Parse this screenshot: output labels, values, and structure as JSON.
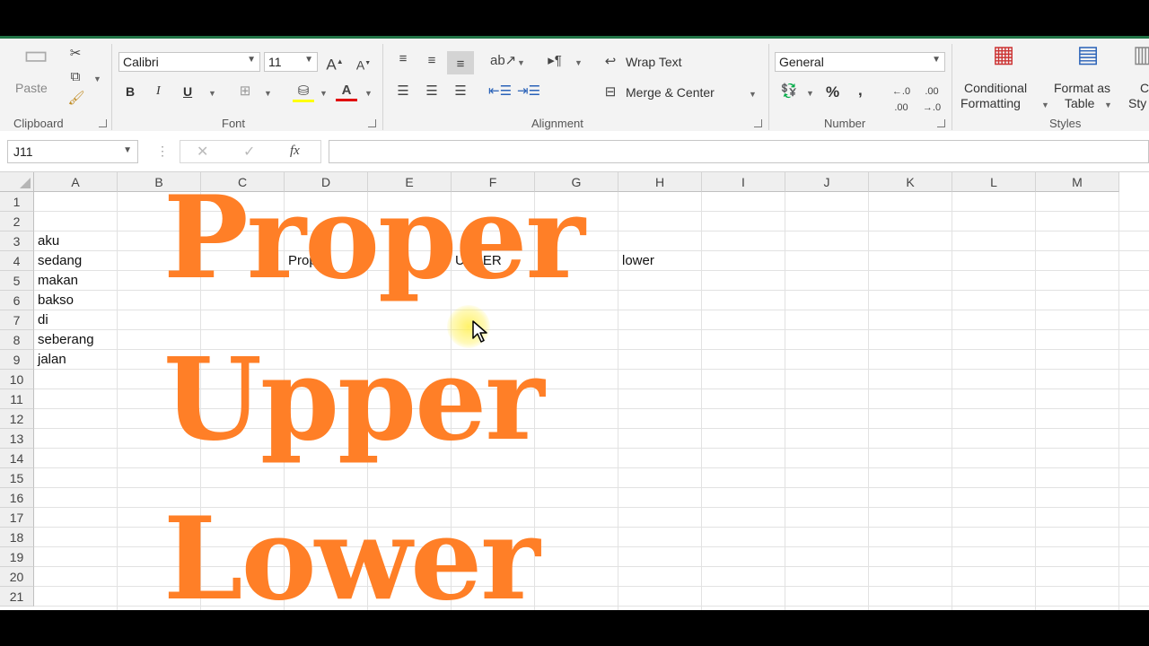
{
  "ribbon": {
    "clipboard": {
      "paste_label": "Paste",
      "group_label": "Clipboard"
    },
    "font": {
      "name": "Calibri",
      "size": "11",
      "bold": "B",
      "italic": "I",
      "underline": "U",
      "group_label": "Font"
    },
    "alignment": {
      "wrap_text": "Wrap Text",
      "merge_center": "Merge & Center",
      "group_label": "Alignment"
    },
    "number": {
      "format": "General",
      "percent": "%",
      "comma": ",",
      "group_label": "Number"
    },
    "styles": {
      "conditional_line1": "Conditional",
      "conditional_line2": "Formatting",
      "format_table_line1": "Format as",
      "format_table_line2": "Table",
      "cell_styles_line1": "C",
      "cell_styles_line2": "Sty",
      "group_label": "Styles"
    }
  },
  "formula_bar": {
    "name_box": "J11",
    "fx": "fx",
    "formula": ""
  },
  "grid": {
    "columns": [
      "A",
      "B",
      "C",
      "D",
      "E",
      "F",
      "G",
      "H",
      "I",
      "J",
      "K",
      "L",
      "M"
    ],
    "rows": [
      "1",
      "2",
      "3",
      "4",
      "5",
      "6",
      "7",
      "8",
      "9",
      "10",
      "11",
      "12",
      "13",
      "14",
      "15",
      "16",
      "17",
      "18",
      "19",
      "20",
      "21"
    ],
    "cells": {
      "A3": "aku",
      "A4": "sedang",
      "A5": "makan",
      "A6": "bakso",
      "A7": "di",
      "A8": "seberang",
      "A9": "jalan",
      "D4": "Proper",
      "F4": "UPPER",
      "H4": "lower"
    }
  },
  "overlay": {
    "line1": "Proper",
    "line2": "Upper",
    "line3": "Lower"
  },
  "colors": {
    "excel_green": "#217346",
    "overlay_orange": "#ff7f27"
  }
}
